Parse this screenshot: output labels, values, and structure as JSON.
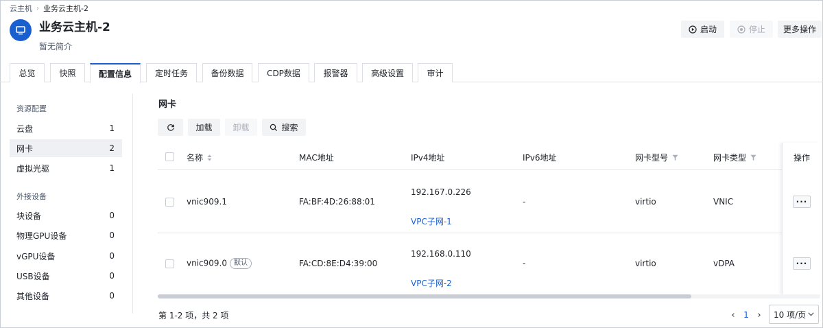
{
  "breadcrumb": {
    "root": "云主机",
    "current": "业务云主机-2"
  },
  "header": {
    "title": "业务云主机-2",
    "description": "暂无简介"
  },
  "actions": {
    "start": "启动",
    "stop": "停止",
    "more": "更多操作"
  },
  "tabs": [
    {
      "label": "总览"
    },
    {
      "label": "快照"
    },
    {
      "label": "配置信息"
    },
    {
      "label": "定时任务"
    },
    {
      "label": "备份数据"
    },
    {
      "label": "CDP数据"
    },
    {
      "label": "报警器"
    },
    {
      "label": "高级设置"
    },
    {
      "label": "审计"
    }
  ],
  "nav": {
    "resource_section": "资源配置",
    "resource_items": [
      {
        "label": "云盘",
        "count": "1"
      },
      {
        "label": "网卡",
        "count": "2"
      },
      {
        "label": "虚拟光驱",
        "count": "1"
      }
    ],
    "external_section": "外接设备",
    "external_items": [
      {
        "label": "块设备",
        "count": "0"
      },
      {
        "label": "物理GPU设备",
        "count": "0"
      },
      {
        "label": "vGPU设备",
        "count": "0"
      },
      {
        "label": "USB设备",
        "count": "0"
      },
      {
        "label": "其他设备",
        "count": "0"
      }
    ]
  },
  "section": {
    "title": "网卡"
  },
  "toolbar": {
    "attach": "加载",
    "detach": "卸载",
    "search": "搜索"
  },
  "table": {
    "columns": {
      "name": "名称",
      "mac": "MAC地址",
      "ipv4": "IPv4地址",
      "ipv6": "IPv6地址",
      "model": "网卡型号",
      "type": "网卡类型",
      "ops": "操作"
    },
    "rows": [
      {
        "name": "vnic909.1",
        "badge": "",
        "mac": "FA:BF:4D:26:88:01",
        "ipv4": "192.167.0.226",
        "subnet": "VPC子网-1",
        "ipv6": "-",
        "model": "virtio",
        "type": "VNIC",
        "ops": "···"
      },
      {
        "name": "vnic909.0",
        "badge": "默认",
        "mac": "FA:CD:8E:D4:39:00",
        "ipv4": "192.168.0.110",
        "subnet": "VPC子网-2",
        "ipv6": "-",
        "model": "virtio",
        "type": "vDPA",
        "ops": "···"
      }
    ]
  },
  "footer": {
    "total": "第 1-2 项，共 2 项",
    "prev": "‹",
    "page": "1",
    "next": "›",
    "page_size": "10 项/页"
  },
  "colors": {
    "accent": "#1a5fd0",
    "border": "#dcdfe6",
    "muted": "#4e5969"
  },
  "icons": {
    "vm": "monitor-icon",
    "start": "play-circle-icon",
    "stop": "stop-circle-icon",
    "refresh": "refresh-icon",
    "search": "search-icon",
    "sort": "sort-icon",
    "filter": "filter-icon"
  }
}
